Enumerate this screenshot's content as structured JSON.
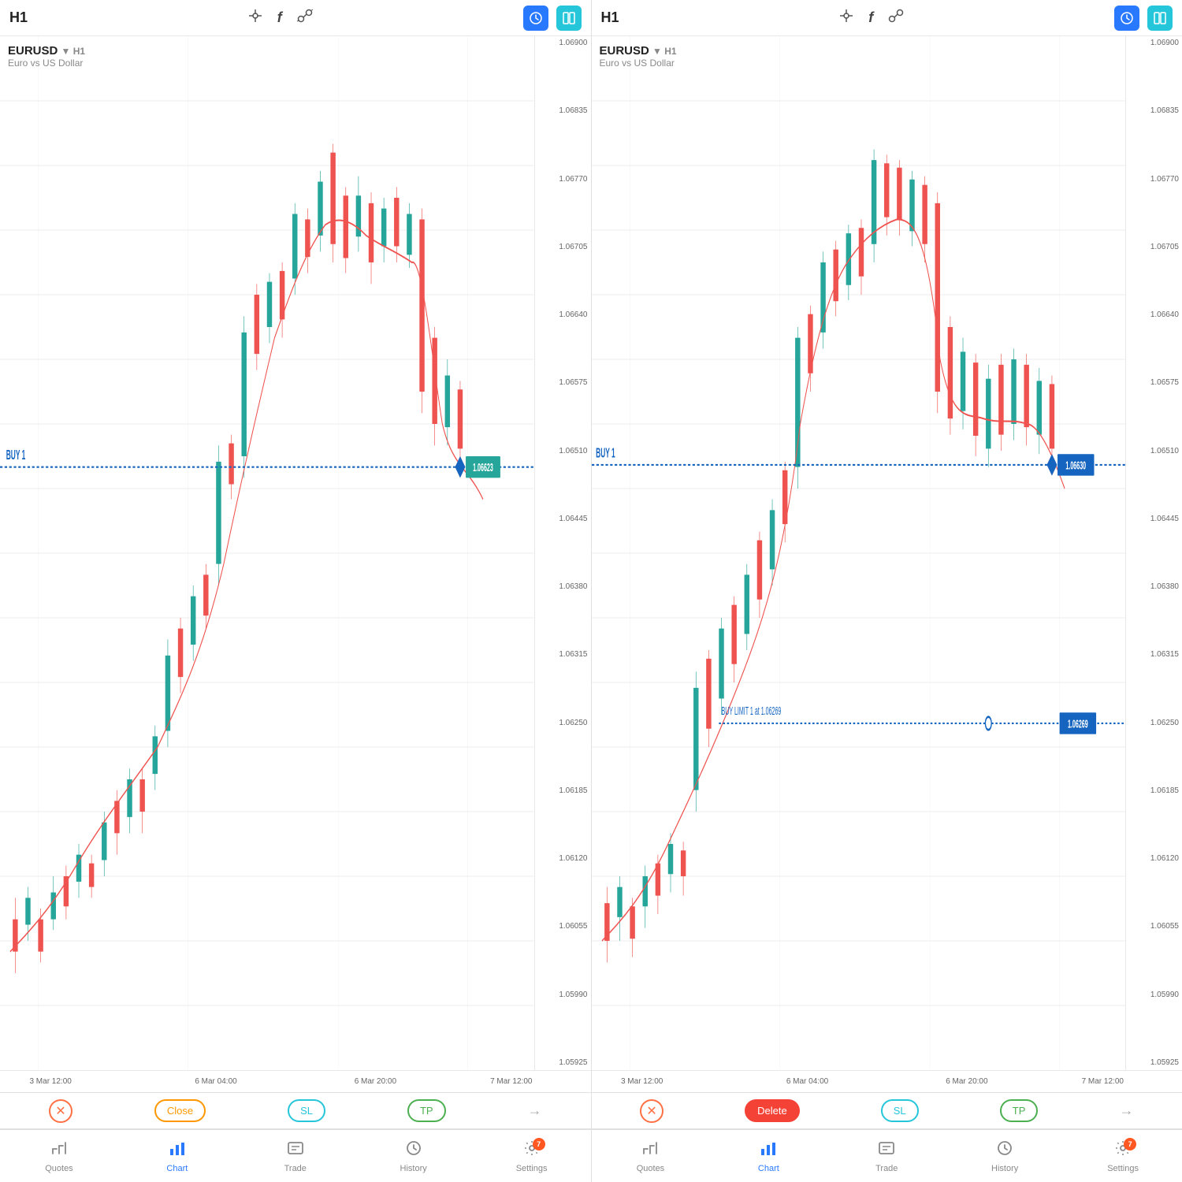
{
  "panels": [
    {
      "id": "left",
      "timeframe": "H1",
      "symbol": "EURUSD",
      "tf_label": "H1",
      "description": "Euro vs US Dollar",
      "buy_line": {
        "label": "BUY 1",
        "price": "1.06623",
        "color_line": "#1565c0",
        "color_tag": "#26a69a",
        "pct_from_top": 42
      },
      "price_levels": [
        "1.06900",
        "1.06835",
        "1.06770",
        "1.06705",
        "1.06640",
        "1.06575",
        "1.06510",
        "1.06445",
        "1.06380",
        "1.06315",
        "1.06250",
        "1.06185",
        "1.06120",
        "1.06055",
        "1.05990",
        "1.05925"
      ],
      "time_labels": [
        {
          "label": "3 Mar 12:00",
          "pct": 8
        },
        {
          "label": "6 Mar 04:00",
          "pct": 38
        },
        {
          "label": "6 Mar 20:00",
          "pct": 68
        },
        {
          "label": "7 Mar 12:00",
          "pct": 91
        }
      ],
      "bottom_actions": {
        "close_x": "✕",
        "btn1": {
          "label": "Close",
          "type": "close"
        },
        "btn2": {
          "label": "SL",
          "type": "sl"
        },
        "btn3": {
          "label": "TP",
          "type": "tp"
        },
        "arrow": "→"
      }
    },
    {
      "id": "right",
      "timeframe": "H1",
      "symbol": "EURUSD",
      "tf_label": "H1",
      "description": "Euro vs US Dollar",
      "buy_line": {
        "label": "BUY 1",
        "price": "1.06630",
        "color_line": "#1565c0",
        "color_tag": "#1565c0",
        "pct_from_top": 42
      },
      "buy_limit_line": {
        "label": "BUY LIMIT 1 at 1.06269",
        "price": "1.06269",
        "pct_from_top": 67
      },
      "price_levels": [
        "1.06900",
        "1.06835",
        "1.06770",
        "1.06705",
        "1.06640",
        "1.06575",
        "1.06510",
        "1.06445",
        "1.06380",
        "1.06315",
        "1.06250",
        "1.06185",
        "1.06120",
        "1.06055",
        "1.05990",
        "1.05925"
      ],
      "time_labels": [
        {
          "label": "3 Mar 12:00",
          "pct": 8
        },
        {
          "label": "6 Mar 04:00",
          "pct": 38
        },
        {
          "label": "6 Mar 20:00",
          "pct": 68
        },
        {
          "label": "7 Mar 12:00",
          "pct": 91
        }
      ],
      "bottom_actions": {
        "close_x": "✕",
        "btn1": {
          "label": "Delete",
          "type": "delete"
        },
        "btn2": {
          "label": "SL",
          "type": "sl"
        },
        "btn3": {
          "label": "TP",
          "type": "tp"
        },
        "arrow": "→"
      }
    }
  ],
  "nav": {
    "left": {
      "items": [
        {
          "id": "quotes",
          "label": "Quotes",
          "icon": "quotes"
        },
        {
          "id": "chart",
          "label": "Chart",
          "icon": "chart",
          "active": true
        },
        {
          "id": "trade",
          "label": "Trade",
          "icon": "trade"
        },
        {
          "id": "history",
          "label": "History",
          "icon": "history"
        },
        {
          "id": "settings",
          "label": "Settings",
          "icon": "settings",
          "badge": "7"
        }
      ]
    },
    "right": {
      "items": [
        {
          "id": "quotes",
          "label": "Quotes",
          "icon": "quotes"
        },
        {
          "id": "chart",
          "label": "Chart",
          "icon": "chart",
          "active": true
        },
        {
          "id": "trade",
          "label": "Trade",
          "icon": "trade"
        },
        {
          "id": "history",
          "label": "History",
          "icon": "history"
        },
        {
          "id": "settings",
          "label": "Settings",
          "icon": "settings",
          "badge": "7"
        }
      ]
    }
  },
  "colors": {
    "bull": "#26a69a",
    "bear": "#ef5350",
    "ma_line": "#ef5350",
    "buy_line": "#1565c0",
    "buy_limit": "#1565c0",
    "price_tag": "#26a69a"
  }
}
